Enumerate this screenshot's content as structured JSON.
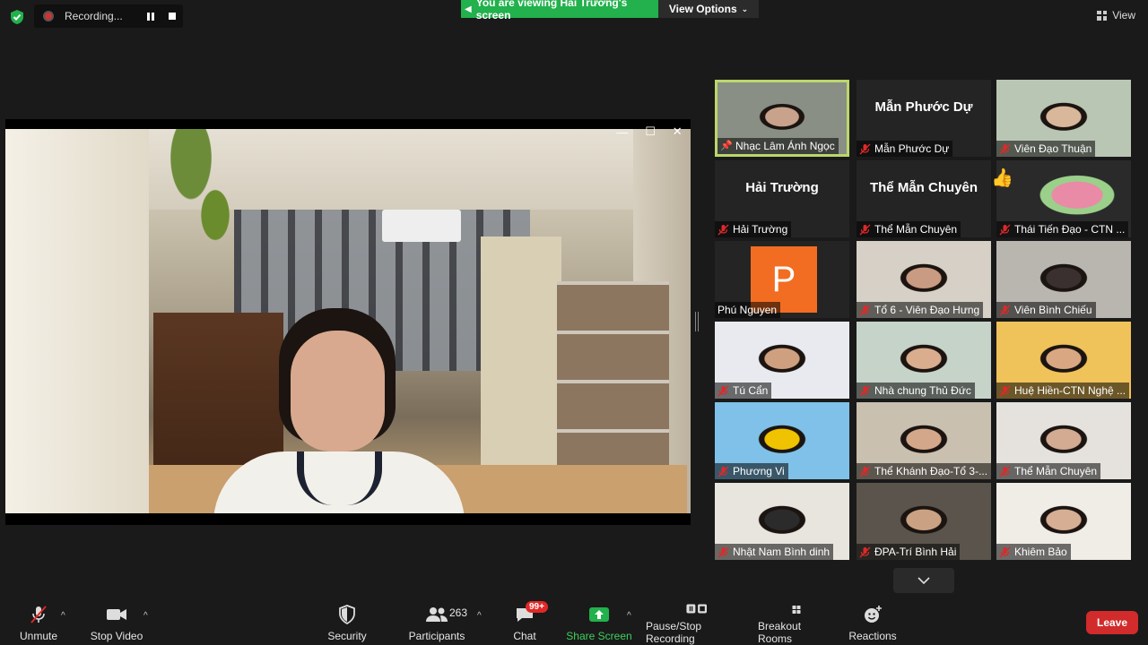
{
  "top": {
    "recording_label": "Recording...",
    "viewing_banner": "You are viewing Hải Trường's screen",
    "view_options": "View Options",
    "view_button": "View"
  },
  "colors": {
    "banner_green": "#22b14c",
    "active_speaker_border": "#bcd66c",
    "leave_red": "#d12b2b",
    "avatar_orange": "#f26d21"
  },
  "gallery": {
    "tiles": [
      {
        "name": "Nhạc Lâm Ánh Ngọc",
        "type": "video",
        "pinned": true,
        "active": true
      },
      {
        "name": "Mẫn Phước Dự",
        "type": "name",
        "title": "Mẫn Phước Dự"
      },
      {
        "name": "Viên Đạo Thuận",
        "type": "video"
      },
      {
        "name": "Hải Trường",
        "type": "name",
        "title": "Hải Trường"
      },
      {
        "name": "Thể Mẫn Chuyên",
        "type": "name",
        "title": "Thể Mẫn Chuyên"
      },
      {
        "name": "Thái Tiến Đạo - CTN ...",
        "type": "image",
        "reaction": "👍"
      },
      {
        "name": "Phú Nguyen",
        "type": "avatar",
        "avatar_letter": "P",
        "muted": false
      },
      {
        "name": "Tổ 6 - Viên Đạo Hưng",
        "type": "video"
      },
      {
        "name": "Viên Bình Chiếu",
        "type": "video"
      },
      {
        "name": "Tú Cẩn",
        "type": "video"
      },
      {
        "name": "Nhà chung Thủ Đức",
        "type": "video"
      },
      {
        "name": "Huệ Hiền-CTN Nghệ ...",
        "type": "video"
      },
      {
        "name": "Phương Vi",
        "type": "video"
      },
      {
        "name": "Thể Khánh Đạo-Tổ 3-...",
        "type": "video"
      },
      {
        "name": "Thể Mẫn Chuyên",
        "type": "video"
      },
      {
        "name": "Nhật Nam Bình dinh",
        "type": "video"
      },
      {
        "name": "ĐPA-Trí Bình Hải",
        "type": "video"
      },
      {
        "name": "Khiêm Bảo",
        "type": "video"
      }
    ]
  },
  "toolbar": {
    "unmute": "Unmute",
    "stop_video": "Stop Video",
    "security": "Security",
    "participants": "Participants",
    "participants_count": "263",
    "chat": "Chat",
    "chat_badge": "99+",
    "share_screen": "Share Screen",
    "pause_stop_recording": "Pause/Stop Recording",
    "breakout_rooms": "Breakout Rooms",
    "reactions": "Reactions",
    "leave": "Leave"
  }
}
